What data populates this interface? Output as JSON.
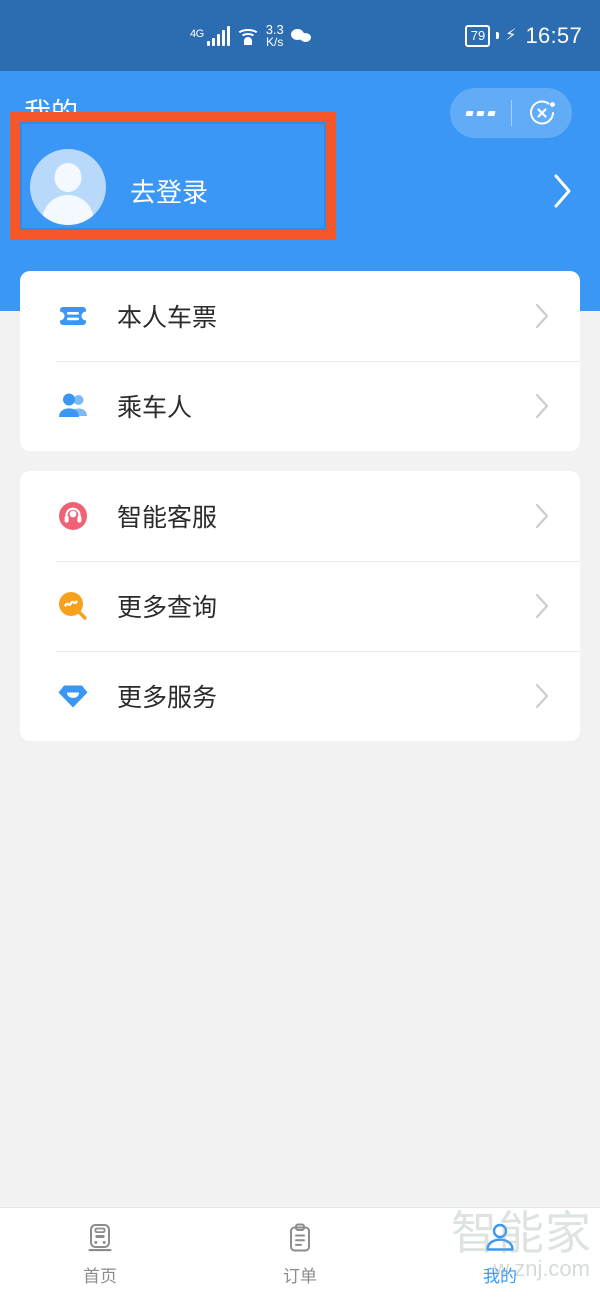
{
  "status_bar": {
    "network_type": "4G",
    "net_speed_value": "3.3",
    "net_speed_unit": "K/s",
    "battery_level": "79",
    "charging_glyph": "⚡",
    "time": "16:57"
  },
  "header": {
    "title": "我的",
    "login_label": "去登录",
    "chevron": "›",
    "capsule": {
      "more_label": "···",
      "close_label": "✕"
    },
    "bg_color": "#3a97f5"
  },
  "annotation": {
    "highlight_color": "#f4582a"
  },
  "cards": [
    {
      "rows": [
        {
          "label": "本人车票",
          "icon": "ticket-icon",
          "icon_color": "#3a97f5"
        },
        {
          "label": "乘车人",
          "icon": "passengers-icon",
          "icon_color": "#3a97f5"
        }
      ]
    },
    {
      "rows": [
        {
          "label": "智能客服",
          "icon": "headset-icon",
          "icon_color": "#ef6275"
        },
        {
          "label": "更多查询",
          "icon": "search-wave-icon",
          "icon_color": "#f6a01e"
        },
        {
          "label": "更多服务",
          "icon": "diamond-smile-icon",
          "icon_color": "#3a97f5"
        }
      ]
    }
  ],
  "tabbar": {
    "items": [
      {
        "label": "首页",
        "icon": "train-icon",
        "active": false
      },
      {
        "label": "订单",
        "icon": "clipboard-icon",
        "active": false
      },
      {
        "label": "我的",
        "icon": "person-icon",
        "active": true
      }
    ],
    "active_color": "#3a97f5",
    "inactive_color": "#8c8c8c"
  },
  "watermark": {
    "brand": "智能家",
    "url": "w.znj.com"
  }
}
